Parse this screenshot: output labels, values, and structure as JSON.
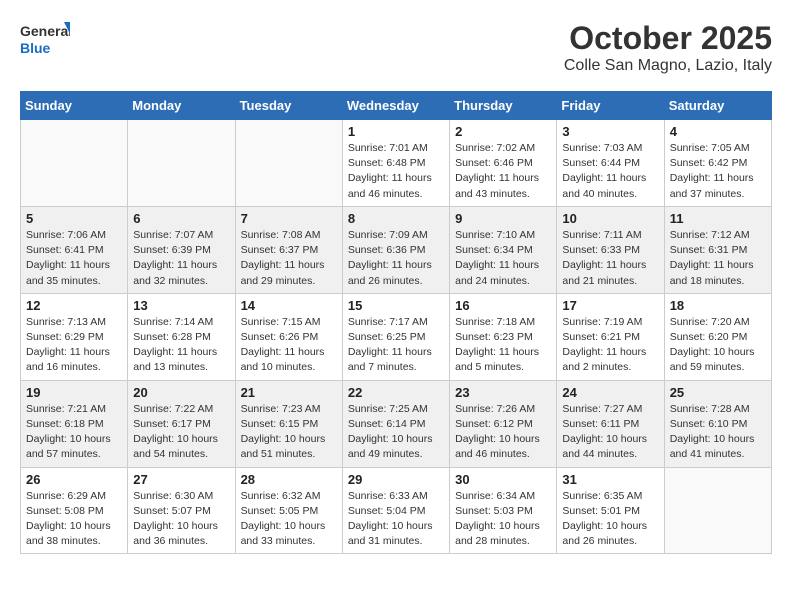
{
  "header": {
    "logo_general": "General",
    "logo_blue": "Blue",
    "month_title": "October 2025",
    "location": "Colle San Magno, Lazio, Italy"
  },
  "days_of_week": [
    "Sunday",
    "Monday",
    "Tuesday",
    "Wednesday",
    "Thursday",
    "Friday",
    "Saturday"
  ],
  "weeks": [
    [
      {
        "day": "",
        "info": ""
      },
      {
        "day": "",
        "info": ""
      },
      {
        "day": "",
        "info": ""
      },
      {
        "day": "1",
        "info": "Sunrise: 7:01 AM\nSunset: 6:48 PM\nDaylight: 11 hours and 46 minutes."
      },
      {
        "day": "2",
        "info": "Sunrise: 7:02 AM\nSunset: 6:46 PM\nDaylight: 11 hours and 43 minutes."
      },
      {
        "day": "3",
        "info": "Sunrise: 7:03 AM\nSunset: 6:44 PM\nDaylight: 11 hours and 40 minutes."
      },
      {
        "day": "4",
        "info": "Sunrise: 7:05 AM\nSunset: 6:42 PM\nDaylight: 11 hours and 37 minutes."
      }
    ],
    [
      {
        "day": "5",
        "info": "Sunrise: 7:06 AM\nSunset: 6:41 PM\nDaylight: 11 hours and 35 minutes."
      },
      {
        "day": "6",
        "info": "Sunrise: 7:07 AM\nSunset: 6:39 PM\nDaylight: 11 hours and 32 minutes."
      },
      {
        "day": "7",
        "info": "Sunrise: 7:08 AM\nSunset: 6:37 PM\nDaylight: 11 hours and 29 minutes."
      },
      {
        "day": "8",
        "info": "Sunrise: 7:09 AM\nSunset: 6:36 PM\nDaylight: 11 hours and 26 minutes."
      },
      {
        "day": "9",
        "info": "Sunrise: 7:10 AM\nSunset: 6:34 PM\nDaylight: 11 hours and 24 minutes."
      },
      {
        "day": "10",
        "info": "Sunrise: 7:11 AM\nSunset: 6:33 PM\nDaylight: 11 hours and 21 minutes."
      },
      {
        "day": "11",
        "info": "Sunrise: 7:12 AM\nSunset: 6:31 PM\nDaylight: 11 hours and 18 minutes."
      }
    ],
    [
      {
        "day": "12",
        "info": "Sunrise: 7:13 AM\nSunset: 6:29 PM\nDaylight: 11 hours and 16 minutes."
      },
      {
        "day": "13",
        "info": "Sunrise: 7:14 AM\nSunset: 6:28 PM\nDaylight: 11 hours and 13 minutes."
      },
      {
        "day": "14",
        "info": "Sunrise: 7:15 AM\nSunset: 6:26 PM\nDaylight: 11 hours and 10 minutes."
      },
      {
        "day": "15",
        "info": "Sunrise: 7:17 AM\nSunset: 6:25 PM\nDaylight: 11 hours and 7 minutes."
      },
      {
        "day": "16",
        "info": "Sunrise: 7:18 AM\nSunset: 6:23 PM\nDaylight: 11 hours and 5 minutes."
      },
      {
        "day": "17",
        "info": "Sunrise: 7:19 AM\nSunset: 6:21 PM\nDaylight: 11 hours and 2 minutes."
      },
      {
        "day": "18",
        "info": "Sunrise: 7:20 AM\nSunset: 6:20 PM\nDaylight: 10 hours and 59 minutes."
      }
    ],
    [
      {
        "day": "19",
        "info": "Sunrise: 7:21 AM\nSunset: 6:18 PM\nDaylight: 10 hours and 57 minutes."
      },
      {
        "day": "20",
        "info": "Sunrise: 7:22 AM\nSunset: 6:17 PM\nDaylight: 10 hours and 54 minutes."
      },
      {
        "day": "21",
        "info": "Sunrise: 7:23 AM\nSunset: 6:15 PM\nDaylight: 10 hours and 51 minutes."
      },
      {
        "day": "22",
        "info": "Sunrise: 7:25 AM\nSunset: 6:14 PM\nDaylight: 10 hours and 49 minutes."
      },
      {
        "day": "23",
        "info": "Sunrise: 7:26 AM\nSunset: 6:12 PM\nDaylight: 10 hours and 46 minutes."
      },
      {
        "day": "24",
        "info": "Sunrise: 7:27 AM\nSunset: 6:11 PM\nDaylight: 10 hours and 44 minutes."
      },
      {
        "day": "25",
        "info": "Sunrise: 7:28 AM\nSunset: 6:10 PM\nDaylight: 10 hours and 41 minutes."
      }
    ],
    [
      {
        "day": "26",
        "info": "Sunrise: 6:29 AM\nSunset: 5:08 PM\nDaylight: 10 hours and 38 minutes."
      },
      {
        "day": "27",
        "info": "Sunrise: 6:30 AM\nSunset: 5:07 PM\nDaylight: 10 hours and 36 minutes."
      },
      {
        "day": "28",
        "info": "Sunrise: 6:32 AM\nSunset: 5:05 PM\nDaylight: 10 hours and 33 minutes."
      },
      {
        "day": "29",
        "info": "Sunrise: 6:33 AM\nSunset: 5:04 PM\nDaylight: 10 hours and 31 minutes."
      },
      {
        "day": "30",
        "info": "Sunrise: 6:34 AM\nSunset: 5:03 PM\nDaylight: 10 hours and 28 minutes."
      },
      {
        "day": "31",
        "info": "Sunrise: 6:35 AM\nSunset: 5:01 PM\nDaylight: 10 hours and 26 minutes."
      },
      {
        "day": "",
        "info": ""
      }
    ]
  ]
}
